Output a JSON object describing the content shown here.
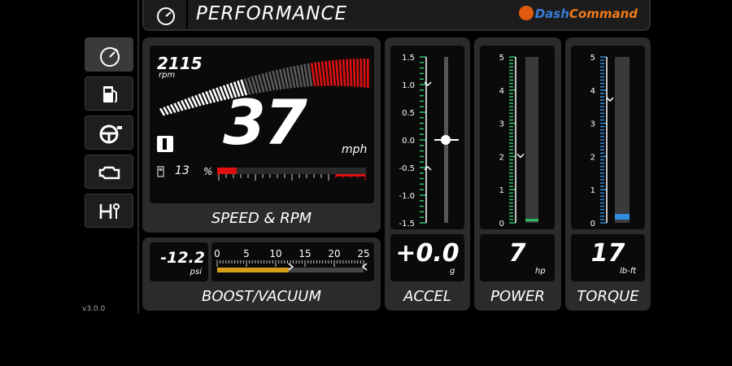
{
  "header": {
    "title": "PERFORMANCE",
    "logo_prefix": "Dash",
    "logo_suffix": "Command",
    "icon": "speedometer-icon"
  },
  "sidebar": {
    "items": [
      {
        "name": "performance",
        "icon": "speedometer-icon",
        "active": true
      },
      {
        "name": "fuel",
        "icon": "fuel-pump-icon",
        "active": false
      },
      {
        "name": "driving",
        "icon": "steering-wheel-icon",
        "active": false
      },
      {
        "name": "diagnostics",
        "icon": "check-engine-icon",
        "active": false
      },
      {
        "name": "gearbox",
        "icon": "shifter-icon",
        "active": false
      }
    ],
    "version": "v3.0.0"
  },
  "speed_rpm": {
    "rpm": "2115",
    "rpm_unit": "rpm",
    "rpm_fraction": 0.3,
    "speed": "37",
    "speed_unit": "mph",
    "gear": "I",
    "fuel_value": "13",
    "fuel_unit": "%",
    "fuel_fraction": 0.13,
    "label": "SPEED & RPM"
  },
  "boost": {
    "value": "-12.2",
    "unit": "psi",
    "scale": [
      "0",
      "5",
      "10",
      "15",
      "20",
      "25"
    ],
    "fill_value": 12.2,
    "max": 25,
    "label": "BOOST/VACUUM"
  },
  "accel": {
    "value": "+0.0",
    "unit": "g",
    "scale": [
      "1.5",
      "1.0",
      "0.5",
      "0.0",
      "-0.5",
      "-1.0",
      "-1.5"
    ],
    "current": 0.0,
    "max_marker": 1.0,
    "min_marker": -0.5,
    "label": "ACCEL"
  },
  "power": {
    "value": "7",
    "unit": "hp",
    "scale": [
      "5",
      "4",
      "3",
      "2",
      "1",
      "0"
    ],
    "multiplier": "x100",
    "current": 7,
    "peak_marker": 200,
    "label": "POWER"
  },
  "torque": {
    "value": "17",
    "unit": "lb-ft",
    "scale": [
      "5",
      "4",
      "3",
      "2",
      "1",
      "0"
    ],
    "multiplier": "x100",
    "current": 17,
    "peak_marker": 370,
    "label": "TORQUE"
  },
  "colors": {
    "power_scale": "#2ec26a",
    "torque_scale": "#2f8fdf",
    "accel_scale": "#2ec26a",
    "redline": "#e01010",
    "boost_fill": "#d4a017",
    "logo": "#f07a1a"
  }
}
